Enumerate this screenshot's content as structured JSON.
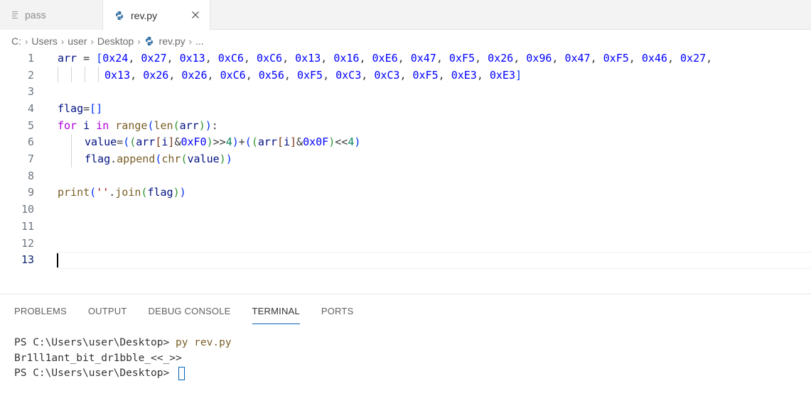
{
  "tabs": [
    {
      "label": "pass",
      "active": false
    },
    {
      "label": "rev.py",
      "active": true
    }
  ],
  "breadcrumb": {
    "drive": "C:",
    "folder1": "Users",
    "folder2": "user",
    "folder3": "Desktop",
    "file": "rev.py",
    "more": "..."
  },
  "editor": {
    "line_numbers": [
      "1",
      "2",
      "3",
      "4",
      "5",
      "6",
      "7",
      "8",
      "9",
      "10",
      "11",
      "12",
      "13"
    ],
    "current_line": "13"
  },
  "panel": {
    "tabs": [
      "PROBLEMS",
      "OUTPUT",
      "DEBUG CONSOLE",
      "TERMINAL",
      "PORTS"
    ],
    "active_tab": "TERMINAL"
  },
  "terminal": {
    "prompt1": "PS C:\\Users\\user\\Desktop> ",
    "command": "py rev.py",
    "output": "Br1ll1ant_bit_dr1bble_<<_>>",
    "prompt2": "PS C:\\Users\\user\\Desktop> "
  },
  "colors": {
    "accent": "#005fb8",
    "keyword": "#af00db",
    "function": "#795e26",
    "hex_literal": "#0000ff",
    "number": "#098658"
  }
}
